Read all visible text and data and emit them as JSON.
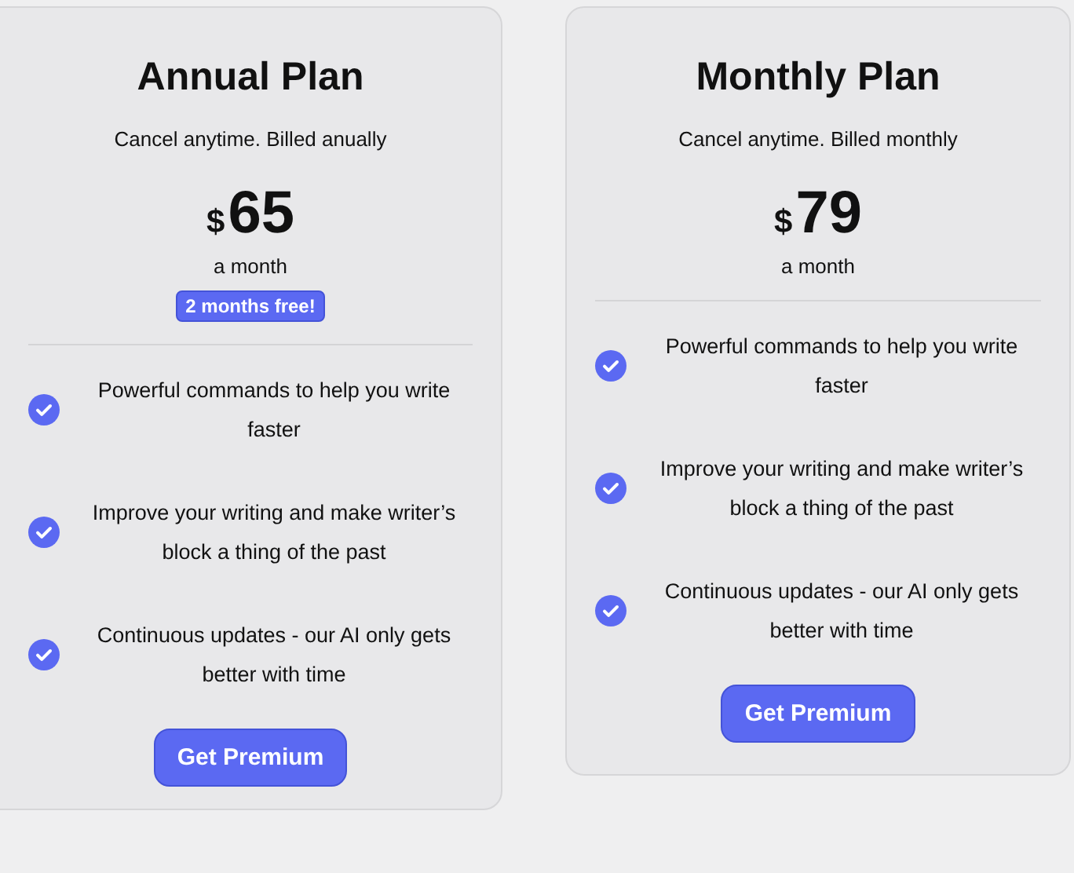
{
  "plans": [
    {
      "title": "Annual Plan",
      "subtitle": "Cancel anytime. Billed anually",
      "currency": "$",
      "amount": "65",
      "period": "a month",
      "badge": "2 months free!",
      "features": [
        {
          "text": "Powerful commands to help you write faster",
          "checked": true
        },
        {
          "text": "Improve your writing and make writer’s block a thing of the past",
          "checked": true
        },
        {
          "text": "Continuous updates - our AI only gets better with time",
          "checked": true
        }
      ],
      "button": "Get Premium"
    },
    {
      "title": "Monthly Plan",
      "subtitle": "Cancel anytime. Billed monthly",
      "currency": "$",
      "amount": "79",
      "period": "a month",
      "features": [
        {
          "text": "Powerful commands to help you write faster",
          "checked": true
        },
        {
          "text": "Improve your writing and make writer’s block a thing of the past",
          "checked": true
        },
        {
          "text": "Continuous updates - our AI only gets better with time",
          "checked": true
        }
      ],
      "button": "Get Premium"
    }
  ]
}
